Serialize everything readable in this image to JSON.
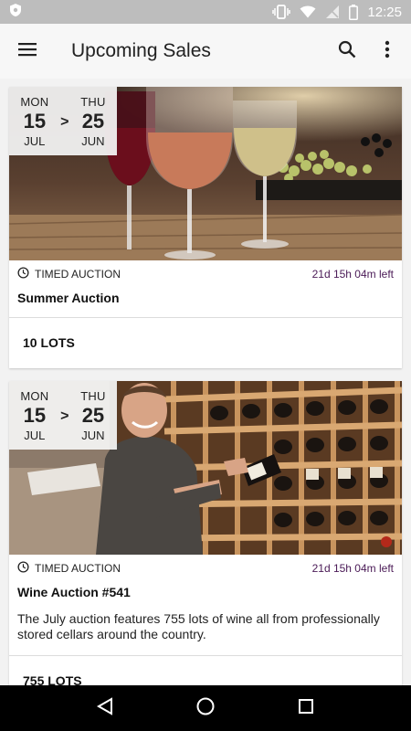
{
  "status_bar": {
    "time": "12:25"
  },
  "app_bar": {
    "title": "Upcoming Sales"
  },
  "cards": [
    {
      "start": {
        "dow": "MON",
        "day": "15",
        "month": "JUL"
      },
      "end": {
        "dow": "THU",
        "day": "25",
        "month": "JUN"
      },
      "separator": ">",
      "type": "TIMED AUCTION",
      "time_left": "21d 15h 04m left",
      "title": "Summer Auction",
      "description": "",
      "lots": "10 LOTS"
    },
    {
      "start": {
        "dow": "MON",
        "day": "15",
        "month": "JUL"
      },
      "end": {
        "dow": "THU",
        "day": "25",
        "month": "JUN"
      },
      "separator": ">",
      "type": "TIMED AUCTION",
      "time_left": "21d 15h 04m left",
      "title": "Wine Auction #541",
      "description": "The July auction features 755 lots of wine all from professionally stored cellars around the country.",
      "lots": "755 LOTS"
    }
  ],
  "icons": {
    "menu": "menu-icon",
    "search": "search-icon",
    "overflow": "more-vert-icon",
    "clock": "clock-icon",
    "back": "back-icon",
    "home": "home-icon",
    "recents": "recents-icon"
  },
  "colors": {
    "time_left": "#4a1a56",
    "status_bar": "#bdbdbd",
    "nav_bar": "#000000"
  }
}
